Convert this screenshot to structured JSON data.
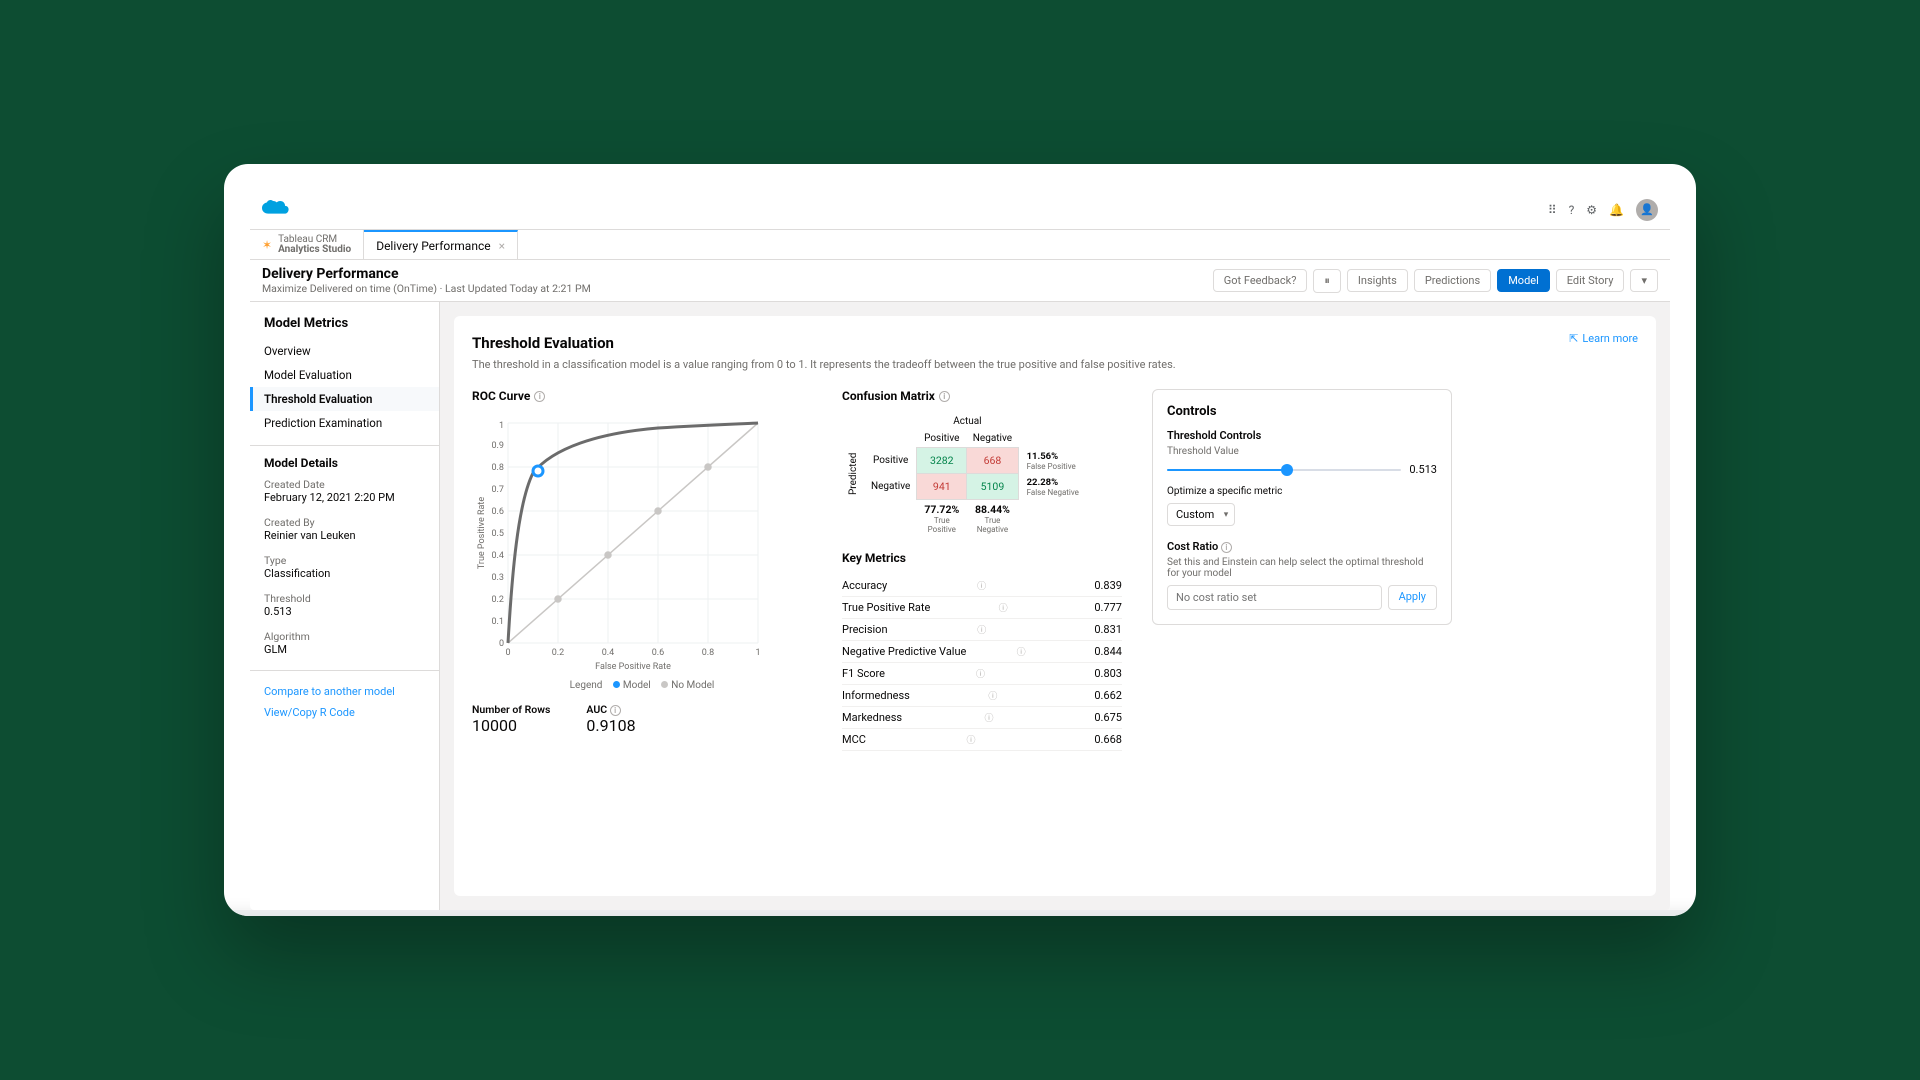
{
  "app_tab": {
    "line1": "Tableau CRM",
    "line2": "Analytics Studio"
  },
  "page_tab": "Delivery Performance",
  "context": {
    "title": "Delivery Performance",
    "subtitle": "Maximize Delivered on time (OnTime) · Last Updated Today at 2:21 PM",
    "buttons": {
      "feedback": "Got Feedback?",
      "insights": "Insights",
      "predictions": "Predictions",
      "model": "Model",
      "edit": "Edit Story"
    }
  },
  "sidebar": {
    "heading": "Model Metrics",
    "items": [
      "Overview",
      "Model Evaluation",
      "Threshold Evaluation",
      "Prediction Examination"
    ],
    "active": 2,
    "details": {
      "heading": "Model Details",
      "created_date": {
        "label": "Created Date",
        "value": "February 12, 2021 2:20 PM"
      },
      "created_by": {
        "label": "Created By",
        "value": "Reinier van Leuken"
      },
      "type": {
        "label": "Type",
        "value": "Classification"
      },
      "threshold": {
        "label": "Threshold",
        "value": "0.513"
      },
      "algorithm": {
        "label": "Algorithm",
        "value": "GLM"
      }
    },
    "links": {
      "compare": "Compare to another model",
      "viewr": "View/Copy R Code"
    }
  },
  "content": {
    "learn_more": "Learn more",
    "title": "Threshold Evaluation",
    "desc": "The threshold in a classification model is a value ranging from 0 to 1. It represents the tradeoff between the true positive and false positive rates.",
    "roc": {
      "title": "ROC Curve",
      "xlabel": "False Positive Rate",
      "ylabel": "True Positive Rate",
      "legend": {
        "label": "Legend",
        "model": "Model",
        "nomodel": "No Model"
      },
      "rows": {
        "label": "Number of Rows",
        "value": "10000"
      },
      "auc": {
        "label": "AUC",
        "value": "0.9108"
      }
    },
    "cm": {
      "title": "Confusion Matrix",
      "actual": "Actual",
      "predicted": "Predicted",
      "positive": "Positive",
      "negative": "Negative",
      "tp": "3282",
      "fn_top": "668",
      "fp_left": "941",
      "tn": "5109",
      "fp": {
        "pct": "11.56%",
        "label": "False Positive"
      },
      "fn": {
        "pct": "22.28%",
        "label": "False Negative"
      },
      "tp_col": {
        "pct": "77.72%",
        "label": "True Positive"
      },
      "tn_col": {
        "pct": "88.44%",
        "label": "True Negative"
      }
    },
    "metrics": {
      "title": "Key Metrics",
      "rows": [
        {
          "label": "Accuracy",
          "value": "0.839"
        },
        {
          "label": "True Positive Rate",
          "value": "0.777"
        },
        {
          "label": "Precision",
          "value": "0.831"
        },
        {
          "label": "Negative Predictive Value",
          "value": "0.844"
        },
        {
          "label": "F1 Score",
          "value": "0.803"
        },
        {
          "label": "Informedness",
          "value": "0.662"
        },
        {
          "label": "Markedness",
          "value": "0.675"
        },
        {
          "label": "MCC",
          "value": "0.668"
        }
      ]
    },
    "controls": {
      "title": "Controls",
      "threshold_controls": "Threshold Controls",
      "threshold_value_label": "Threshold Value",
      "threshold_value": "0.513",
      "slider_pct": 51.3,
      "optimize_label": "Optimize a specific metric",
      "optimize_select": "Custom",
      "cost_ratio_label": "Cost Ratio",
      "cost_ratio_desc": "Set this and Einstein can help select the optimal threshold for your model",
      "cost_placeholder": "No cost ratio set",
      "apply": "Apply"
    }
  },
  "chart_data": {
    "type": "line",
    "title": "ROC Curve",
    "xlabel": "False Positive Rate",
    "ylabel": "True Positive Rate",
    "xlim": [
      0,
      1
    ],
    "ylim": [
      0,
      1
    ],
    "series": [
      {
        "name": "Model",
        "x": [
          0,
          0.02,
          0.05,
          0.1,
          0.12,
          0.2,
          0.3,
          0.4,
          0.6,
          0.8,
          1.0
        ],
        "y": [
          0,
          0.45,
          0.68,
          0.78,
          0.8,
          0.9,
          0.95,
          0.97,
          0.99,
          0.995,
          1.0
        ]
      },
      {
        "name": "No Model",
        "x": [
          0,
          0.2,
          0.4,
          0.6,
          0.8,
          1.0
        ],
        "y": [
          0,
          0.2,
          0.4,
          0.6,
          0.8,
          1.0
        ]
      }
    ],
    "threshold_point": {
      "fpr": 0.12,
      "tpr": 0.78
    },
    "auc": 0.9108,
    "n_rows": 10000
  }
}
